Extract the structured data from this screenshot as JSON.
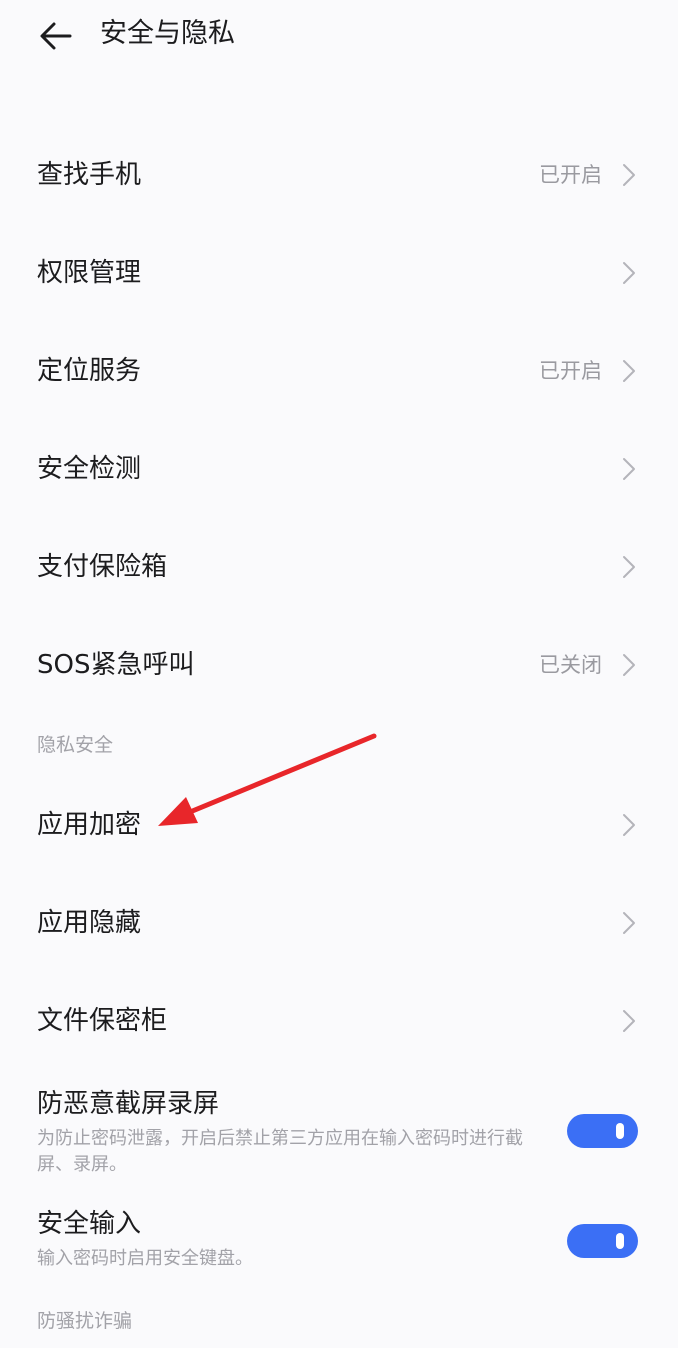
{
  "header": {
    "back_icon": "arrow-left-icon",
    "title": "安全与隐私"
  },
  "items": [
    {
      "label": "查找手机",
      "status": "已开启"
    },
    {
      "label": "权限管理",
      "status": ""
    },
    {
      "label": "定位服务",
      "status": "已开启"
    },
    {
      "label": "安全检测",
      "status": ""
    },
    {
      "label": "支付保险箱",
      "status": ""
    },
    {
      "label": "SOS紧急呼叫",
      "status": "已关闭"
    }
  ],
  "privacy_section": {
    "header": "隐私安全",
    "items": [
      {
        "label": "应用加密"
      },
      {
        "label": "应用隐藏"
      },
      {
        "label": "文件保密柜"
      }
    ]
  },
  "toggles": [
    {
      "title": "防恶意截屏录屏",
      "description": "为防止密码泄露，开启后禁止第三方应用在输入密码时进行截屏、录屏。",
      "enabled": true
    },
    {
      "title": "安全输入",
      "description": "输入密码时启用安全键盘。",
      "enabled": true
    }
  ],
  "fraud_section": {
    "header": "防骚扰诈骗"
  },
  "colors": {
    "accent": "#3b6ff5",
    "annotation": "#e8262a",
    "secondary_text": "#9a9aa0",
    "background": "#fafafc"
  },
  "chevron_icon": "chevron-right-icon"
}
